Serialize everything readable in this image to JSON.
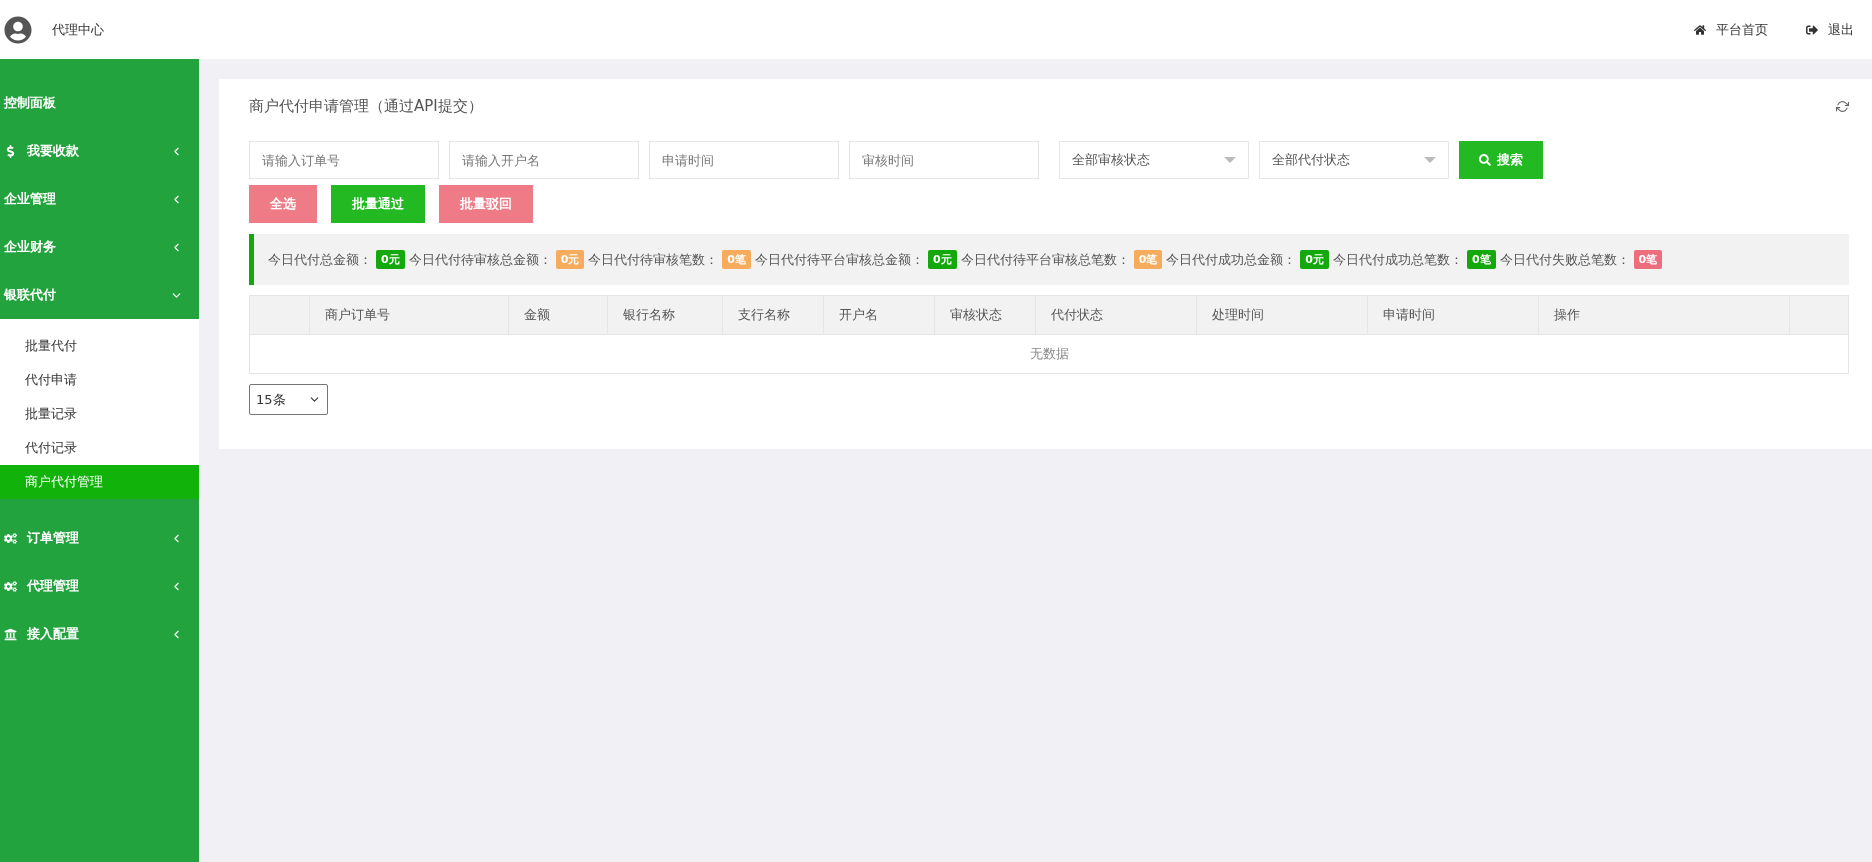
{
  "header": {
    "title": "代理中心",
    "links": [
      {
        "label": "平台首页"
      },
      {
        "label": "退出"
      }
    ]
  },
  "sidebar": {
    "items": [
      {
        "label": "控制面板",
        "kind": "plain",
        "has_children": false,
        "expanded": false
      },
      {
        "label": "我要收款",
        "kind": "dollar",
        "has_children": true,
        "expanded": false
      },
      {
        "label": "企业管理",
        "kind": "plain",
        "has_children": true,
        "expanded": false
      },
      {
        "label": "企业财务",
        "kind": "plain",
        "has_children": true,
        "expanded": false
      },
      {
        "label": "银联代付",
        "kind": "plain",
        "has_children": true,
        "expanded": true,
        "children": [
          {
            "label": "批量代付",
            "selected": false
          },
          {
            "label": "代付申请",
            "selected": false
          },
          {
            "label": "批量记录",
            "selected": false
          },
          {
            "label": "代付记录",
            "selected": false
          },
          {
            "label": "商户代付管理",
            "selected": true
          }
        ]
      },
      {
        "label": "订单管理",
        "kind": "gears",
        "has_children": true,
        "expanded": false
      },
      {
        "label": "代理管理",
        "kind": "gears",
        "has_children": true,
        "expanded": false
      },
      {
        "label": "接入配置",
        "kind": "bank",
        "has_children": true,
        "expanded": false
      }
    ]
  },
  "panel": {
    "title": "商户代付申请管理（通过API提交）",
    "filters": [
      {
        "kind": "input",
        "placeholder": "请输入订单号"
      },
      {
        "kind": "input",
        "placeholder": "请输入开户名"
      },
      {
        "kind": "input",
        "placeholder": "申请时间"
      },
      {
        "kind": "input",
        "placeholder": "审核时间"
      },
      {
        "kind": "select",
        "value": "全部审核状态"
      },
      {
        "kind": "select",
        "value": "全部代付状态"
      }
    ],
    "search_button": "搜索",
    "actions": [
      {
        "label": "全选",
        "color": "#ef7b87"
      },
      {
        "label": "批量通过",
        "color": "#22b922"
      },
      {
        "label": "批量驳回",
        "color": "#ef7b87"
      }
    ],
    "stats": [
      {
        "label": "今日代付总金额：",
        "value": "0元",
        "color": "#14a80c"
      },
      {
        "label": "今日代付待审核总金额：",
        "value": "0元",
        "color": "#f7ab5c"
      },
      {
        "label": "今日代付待审核笔数：",
        "value": "0笔",
        "color": "#f7ab5c"
      },
      {
        "label": "今日代付待平台审核总金额：",
        "value": "0元",
        "color": "#14a80c"
      },
      {
        "label": "今日代付待平台审核总笔数：",
        "value": "0笔",
        "color": "#f7ab5c"
      },
      {
        "label": "今日代付成功总金额：",
        "value": "0元",
        "color": "#14a80c"
      },
      {
        "label": "今日代付成功总笔数：",
        "value": "0笔",
        "color": "#14a80c"
      },
      {
        "label": "今日代付失败总笔数：",
        "value": "0笔",
        "color": "#ec6d7c"
      }
    ],
    "table": {
      "columns": [
        "商户订单号",
        "金额",
        "银行名称",
        "支行名称",
        "开户名",
        "审核状态",
        "代付状态",
        "处理时间",
        "申请时间",
        "操作"
      ],
      "empty_text": "无数据"
    },
    "page_size": "15条"
  }
}
